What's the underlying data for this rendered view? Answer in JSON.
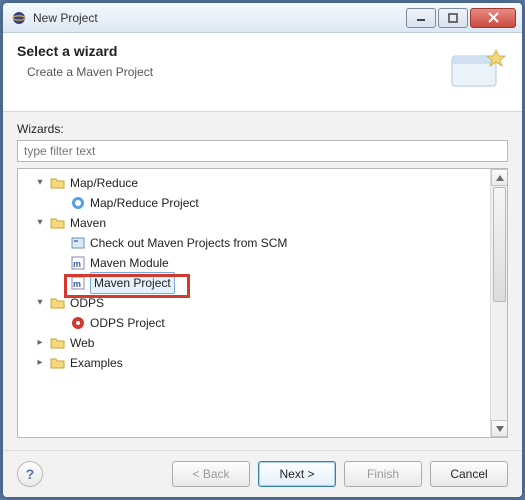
{
  "window": {
    "title": "New Project"
  },
  "banner": {
    "title": "Select a wizard",
    "subtitle": "Create a Maven Project"
  },
  "wizards_label": "Wizards:",
  "filter": {
    "placeholder": "type filter text"
  },
  "tree": {
    "nodes": [
      {
        "label": "Map/Reduce",
        "expanded": true,
        "kind": "category",
        "children": [
          {
            "label": "Map/Reduce Project",
            "icon": "mr-project"
          }
        ]
      },
      {
        "label": "Maven",
        "expanded": true,
        "kind": "category",
        "children": [
          {
            "label": "Check out Maven Projects from SCM",
            "icon": "scm"
          },
          {
            "label": "Maven Module",
            "icon": "maven-mod"
          },
          {
            "label": "Maven Project",
            "icon": "maven-proj",
            "selected": true
          }
        ]
      },
      {
        "label": "ODPS",
        "expanded": true,
        "kind": "category",
        "children": [
          {
            "label": "ODPS Project",
            "icon": "odps"
          }
        ]
      },
      {
        "label": "Web",
        "expanded": false,
        "kind": "category"
      },
      {
        "label": "Examples",
        "expanded": false,
        "kind": "category"
      }
    ]
  },
  "buttons": {
    "back": "< Back",
    "next": "Next >",
    "finish": "Finish",
    "cancel": "Cancel"
  }
}
